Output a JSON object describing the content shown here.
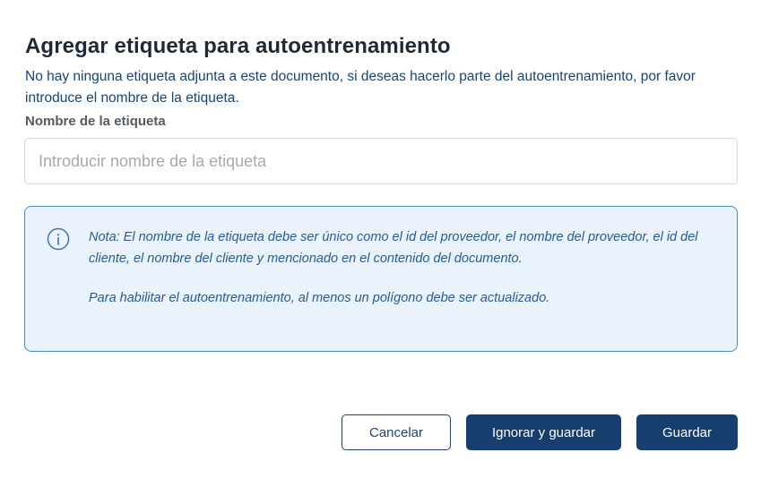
{
  "dialog": {
    "title": "Agregar etiqueta para autoentrenamiento",
    "description": "No hay ninguna etiqueta adjunta a este documento, si deseas hacerlo parte del autoentrenamiento, por favor introduce el nombre de la etiqueta.",
    "field_label": "Nombre de la etiqueta",
    "input": {
      "value": "",
      "placeholder": "Introducir nombre de la etiqueta"
    },
    "note": {
      "icon": "info-icon",
      "paragraph_1": "Nota: El nombre de la etiqueta debe ser único como el id del proveedor, el nombre del proveedor, el id del cliente, el nombre del cliente y mencionado en el contenido del documento.",
      "paragraph_2": "Para habilitar el autoentrenamiento, al menos un polígono debe ser actualizado."
    },
    "buttons": {
      "cancel": "Cancelar",
      "ignore_and_save": "Ignorar y guardar",
      "save": "Guardar"
    }
  },
  "colors": {
    "primary": "#163e6e",
    "note_background": "#eaf3fb",
    "note_border": "#4f86c4",
    "description_text": "#14457a"
  }
}
